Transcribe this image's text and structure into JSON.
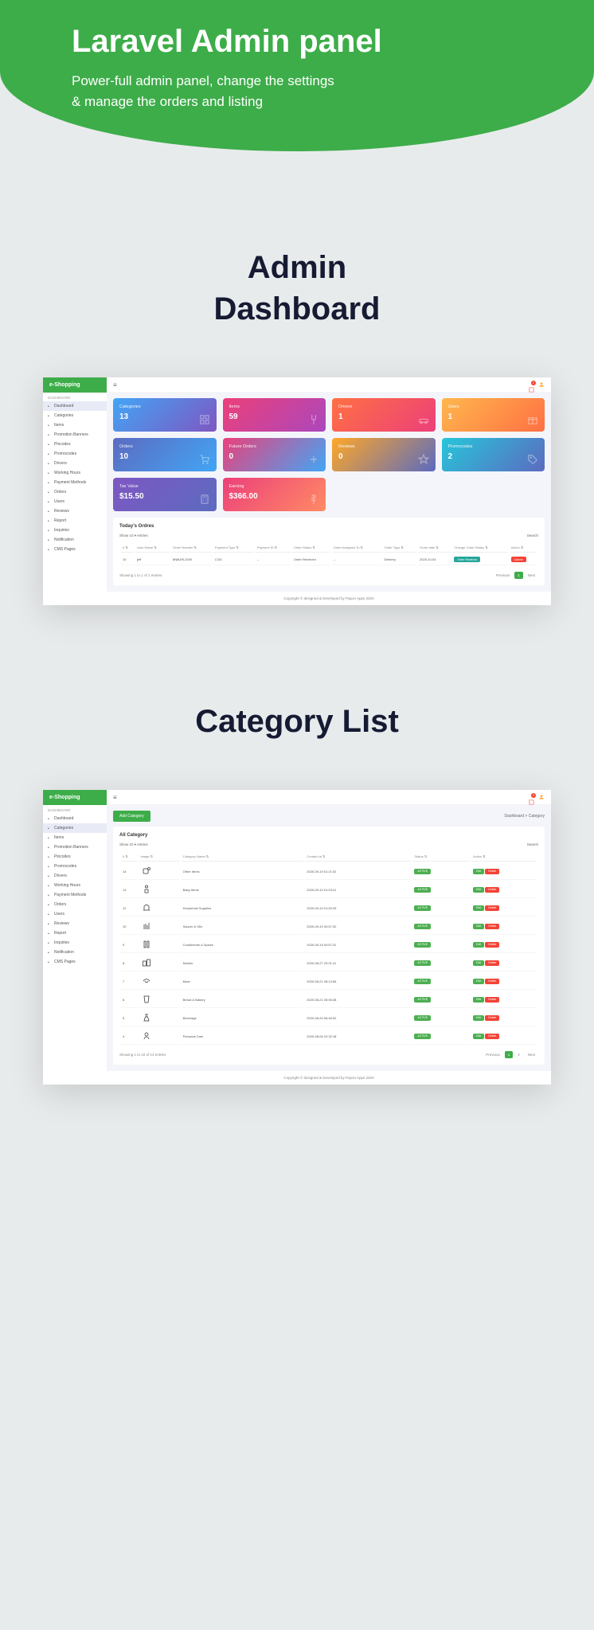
{
  "hero": {
    "title": "Laravel Admin panel",
    "subtitle1": "Power-full admin panel, change the settings",
    "subtitle2": "& manage the orders and listing"
  },
  "section1": "Admin\nDashboard",
  "section2": "Category List",
  "brand": "e-Shopping",
  "sidebar": {
    "sect": "DASHBOARD",
    "items": [
      "Dashboard",
      "Categories",
      "Items",
      "Promotion Banners",
      "Pincodes",
      "Promocodes",
      "Drivers",
      "Working Hours",
      "Payment Methods",
      "Orders",
      "Users",
      "Reviews",
      "Report",
      "Inquiries",
      "Notification",
      "CMS Pages"
    ]
  },
  "topbar": {
    "notif": "2"
  },
  "dash": {
    "cards": [
      {
        "cls": "c-cat",
        "label": "Categories",
        "val": "13"
      },
      {
        "cls": "c-items",
        "label": "Items",
        "val": "59"
      },
      {
        "cls": "c-drv",
        "label": "Drivers",
        "val": "1"
      },
      {
        "cls": "c-usr",
        "label": "Users",
        "val": "1"
      },
      {
        "cls": "c-ord",
        "label": "Orders",
        "val": "10"
      },
      {
        "cls": "c-fut",
        "label": "Future Orders",
        "val": "0"
      },
      {
        "cls": "c-rev",
        "label": "Reviews",
        "val": "0"
      },
      {
        "cls": "c-prom",
        "label": "Promocodes",
        "val": "2"
      }
    ],
    "cards2": [
      {
        "cls": "c-tax",
        "label": "Tax Value",
        "val": "$15.50"
      },
      {
        "cls": "c-earn",
        "label": "Earning",
        "val": "$366.00"
      }
    ],
    "order_panel": {
      "title": "Today's Ordres",
      "show": "Show",
      "entries": "entries",
      "search": "Search",
      "cols": [
        "#",
        "User Name",
        "Order Number",
        "Payment Type",
        "Payment ID",
        "Order Status",
        "Order Assigned To",
        "Order Type",
        "Order date",
        "Change Order Status",
        "Action"
      ],
      "row": {
        "n": "10",
        "user": "jeff",
        "num": "8N8URL2000",
        "ptype": "COD",
        "pid": "--",
        "status": "Order Received",
        "assigned": "--",
        "otype": "Delivery",
        "date": "2020-10-04",
        "chg": "Order Received",
        "act": "Cancel"
      },
      "info": "Showing 1 to 1 of 1 entries",
      "prev": "Previous",
      "page": "1",
      "next": "Next"
    }
  },
  "footer": "Copyright © designed & Developed by Papon Apps 2020",
  "cat": {
    "crumb": "Dashboard > Category",
    "add": "Add Category",
    "title": "All Category",
    "show": "Show",
    "entries": "entries",
    "search": "Search",
    "cols": [
      "#",
      "Image",
      "Category Name",
      "Created at",
      "Status",
      "Action"
    ],
    "rows": [
      {
        "n": "14",
        "name": "Other Items",
        "date": "2020-09-19 01:21:02"
      },
      {
        "n": "13",
        "name": "Baby Items",
        "date": "2020-09-19 01:03:41"
      },
      {
        "n": "12",
        "name": "Household Supplies",
        "date": "2020-09-19 01:00:33"
      },
      {
        "n": "10",
        "name": "Saucer & Oils",
        "date": "2020-09-19 00:57:32"
      },
      {
        "n": "9",
        "name": "Condiments & Spices",
        "date": "2020-09-19 00:57:31"
      },
      {
        "n": "8",
        "name": "Diaries",
        "date": "2020-08-27 20:21:41"
      },
      {
        "n": "7",
        "name": "Meat",
        "date": "2020-08-21 08:13:56"
      },
      {
        "n": "6",
        "name": "Bread & Bakery",
        "date": "2020-08-21 05:06:38"
      },
      {
        "n": "5",
        "name": "Beverage",
        "date": "2020-08-20 06:46:52"
      },
      {
        "n": "4",
        "name": "Personal Care",
        "date": "2020-08-06 22:32:18"
      }
    ],
    "status": "ACTIVE",
    "edit": "Edit",
    "del": "Delete",
    "info": "Showing 1 to 10 of 13 entries",
    "prev": "Previous",
    "p1": "1",
    "p2": "2",
    "next": "Next"
  }
}
